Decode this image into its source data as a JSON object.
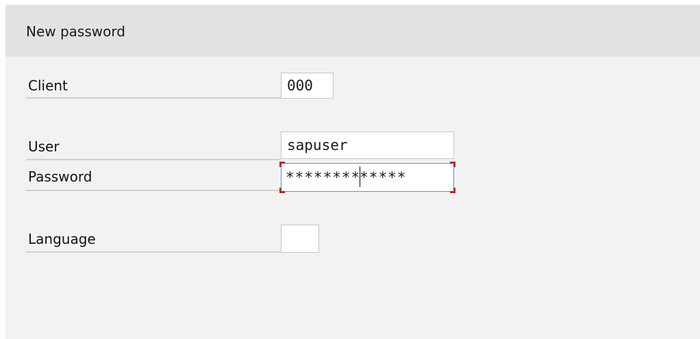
{
  "header": {
    "title": "New password"
  },
  "form": {
    "client": {
      "label": "Client",
      "value": "000"
    },
    "user": {
      "label": "User",
      "value": "sapuser"
    },
    "password": {
      "label": "Password",
      "value_before_caret": "********",
      "value_after_caret": "*****"
    },
    "language": {
      "label": "Language",
      "value": ""
    }
  },
  "colors": {
    "focus_marker": "#d21a1a",
    "focus_border": "#5b94c8",
    "panel_background": "#f2f2f2",
    "header_background": "#e2e2e2"
  }
}
